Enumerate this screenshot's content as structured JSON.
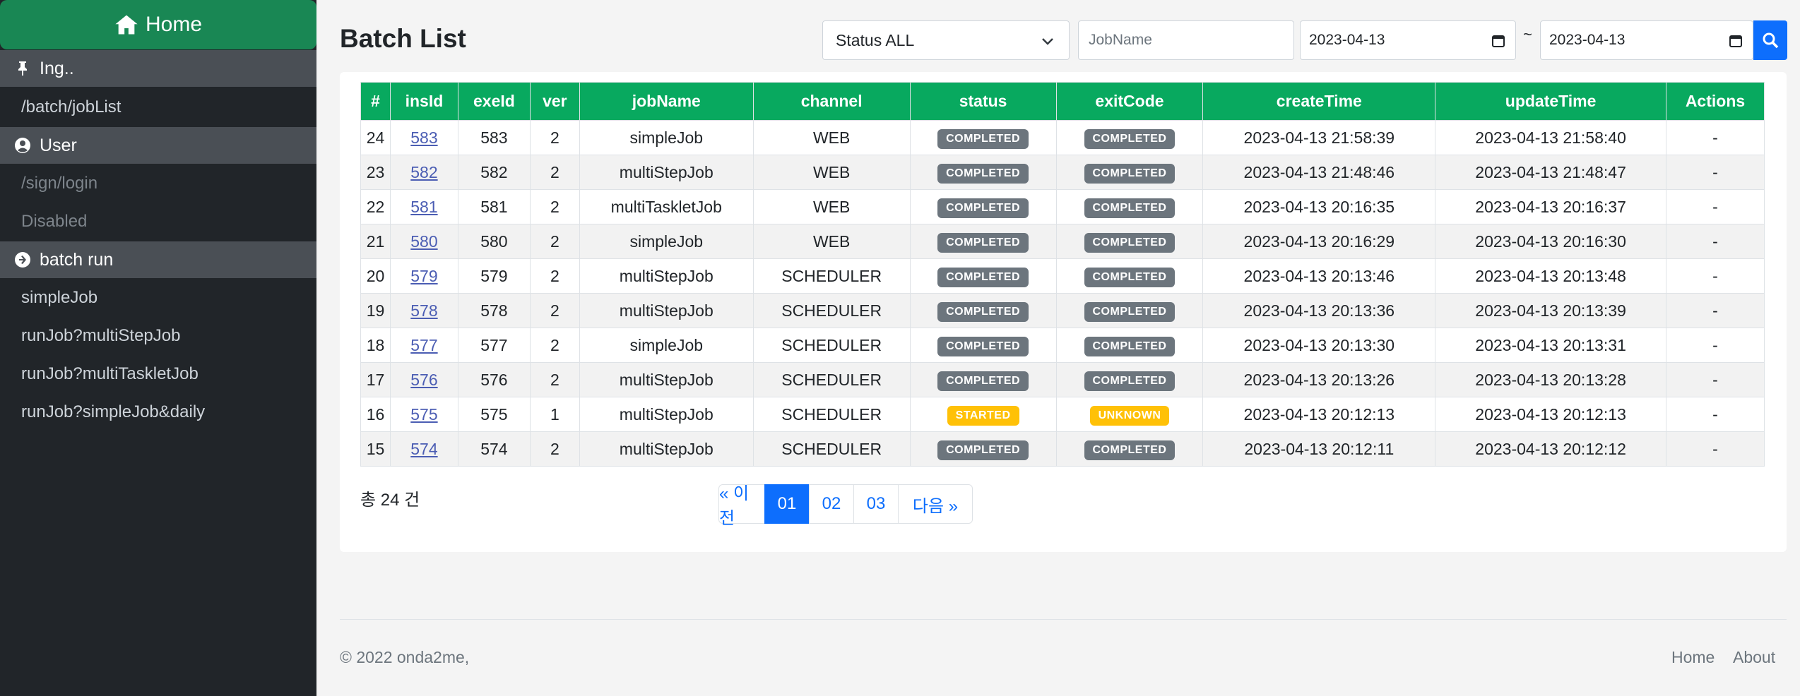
{
  "sidebar": {
    "home_label": "Home",
    "sections": [
      {
        "label": "Ing..",
        "icon": "pin-icon"
      },
      {
        "label": "User",
        "icon": "user-circle-icon"
      },
      {
        "label": "batch run",
        "icon": "arrow-circle-right-icon"
      }
    ],
    "ing_items": [
      "/batch/jobList"
    ],
    "user_items": [
      "/sign/login",
      "Disabled"
    ],
    "batch_items": [
      "simpleJob",
      "runJob?multiStepJob",
      "runJob?multiTaskletJob",
      "runJob?simpleJob&daily"
    ]
  },
  "header": {
    "title": "Batch List",
    "status_select": "Status ALL",
    "jobname_placeholder": "JobName",
    "date_from": "2023-04-13",
    "date_sep": "~",
    "date_to": "2023-04-13"
  },
  "table": {
    "columns": [
      "#",
      "insId",
      "exeId",
      "ver",
      "jobName",
      "channel",
      "status",
      "exitCode",
      "createTime",
      "updateTime",
      "Actions"
    ],
    "rows": [
      {
        "no": "24",
        "insId": "583",
        "exeId": "583",
        "ver": "2",
        "jobName": "simpleJob",
        "channel": "WEB",
        "status": "COMPLETED",
        "exitCode": "COMPLETED",
        "createTime": "2023-04-13 21:58:39",
        "updateTime": "2023-04-13 21:58:40",
        "actions": "-"
      },
      {
        "no": "23",
        "insId": "582",
        "exeId": "582",
        "ver": "2",
        "jobName": "multiStepJob",
        "channel": "WEB",
        "status": "COMPLETED",
        "exitCode": "COMPLETED",
        "createTime": "2023-04-13 21:48:46",
        "updateTime": "2023-04-13 21:48:47",
        "actions": "-"
      },
      {
        "no": "22",
        "insId": "581",
        "exeId": "581",
        "ver": "2",
        "jobName": "multiTaskletJob",
        "channel": "WEB",
        "status": "COMPLETED",
        "exitCode": "COMPLETED",
        "createTime": "2023-04-13 20:16:35",
        "updateTime": "2023-04-13 20:16:37",
        "actions": "-"
      },
      {
        "no": "21",
        "insId": "580",
        "exeId": "580",
        "ver": "2",
        "jobName": "simpleJob",
        "channel": "WEB",
        "status": "COMPLETED",
        "exitCode": "COMPLETED",
        "createTime": "2023-04-13 20:16:29",
        "updateTime": "2023-04-13 20:16:30",
        "actions": "-"
      },
      {
        "no": "20",
        "insId": "579",
        "exeId": "579",
        "ver": "2",
        "jobName": "multiStepJob",
        "channel": "SCHEDULER",
        "status": "COMPLETED",
        "exitCode": "COMPLETED",
        "createTime": "2023-04-13 20:13:46",
        "updateTime": "2023-04-13 20:13:48",
        "actions": "-"
      },
      {
        "no": "19",
        "insId": "578",
        "exeId": "578",
        "ver": "2",
        "jobName": "multiStepJob",
        "channel": "SCHEDULER",
        "status": "COMPLETED",
        "exitCode": "COMPLETED",
        "createTime": "2023-04-13 20:13:36",
        "updateTime": "2023-04-13 20:13:39",
        "actions": "-"
      },
      {
        "no": "18",
        "insId": "577",
        "exeId": "577",
        "ver": "2",
        "jobName": "simpleJob",
        "channel": "SCHEDULER",
        "status": "COMPLETED",
        "exitCode": "COMPLETED",
        "createTime": "2023-04-13 20:13:30",
        "updateTime": "2023-04-13 20:13:31",
        "actions": "-"
      },
      {
        "no": "17",
        "insId": "576",
        "exeId": "576",
        "ver": "2",
        "jobName": "multiStepJob",
        "channel": "SCHEDULER",
        "status": "COMPLETED",
        "exitCode": "COMPLETED",
        "createTime": "2023-04-13 20:13:26",
        "updateTime": "2023-04-13 20:13:28",
        "actions": "-"
      },
      {
        "no": "16",
        "insId": "575",
        "exeId": "575",
        "ver": "1",
        "jobName": "multiStepJob",
        "channel": "SCHEDULER",
        "status": "STARTED",
        "exitCode": "UNKNOWN",
        "createTime": "2023-04-13 20:12:13",
        "updateTime": "2023-04-13 20:12:13",
        "actions": "-"
      },
      {
        "no": "15",
        "insId": "574",
        "exeId": "574",
        "ver": "2",
        "jobName": "multiStepJob",
        "channel": "SCHEDULER",
        "status": "COMPLETED",
        "exitCode": "COMPLETED",
        "createTime": "2023-04-13 20:12:11",
        "updateTime": "2023-04-13 20:12:12",
        "actions": "-"
      }
    ]
  },
  "summary": {
    "total": "총 24 건"
  },
  "pagination": {
    "prev": "« 이전",
    "pages": [
      "01",
      "02",
      "03"
    ],
    "active": "01",
    "next": "다음 »"
  },
  "footer": {
    "copyright": "© 2022 onda2me,",
    "links": [
      "Home",
      "About"
    ]
  },
  "colors": {
    "sidebar_bg": "#212529",
    "home_green": "#198754",
    "header_green": "#08a95f",
    "primary": "#0d6efd",
    "badge_gray": "#6c757d",
    "badge_warn": "#ffc107"
  }
}
